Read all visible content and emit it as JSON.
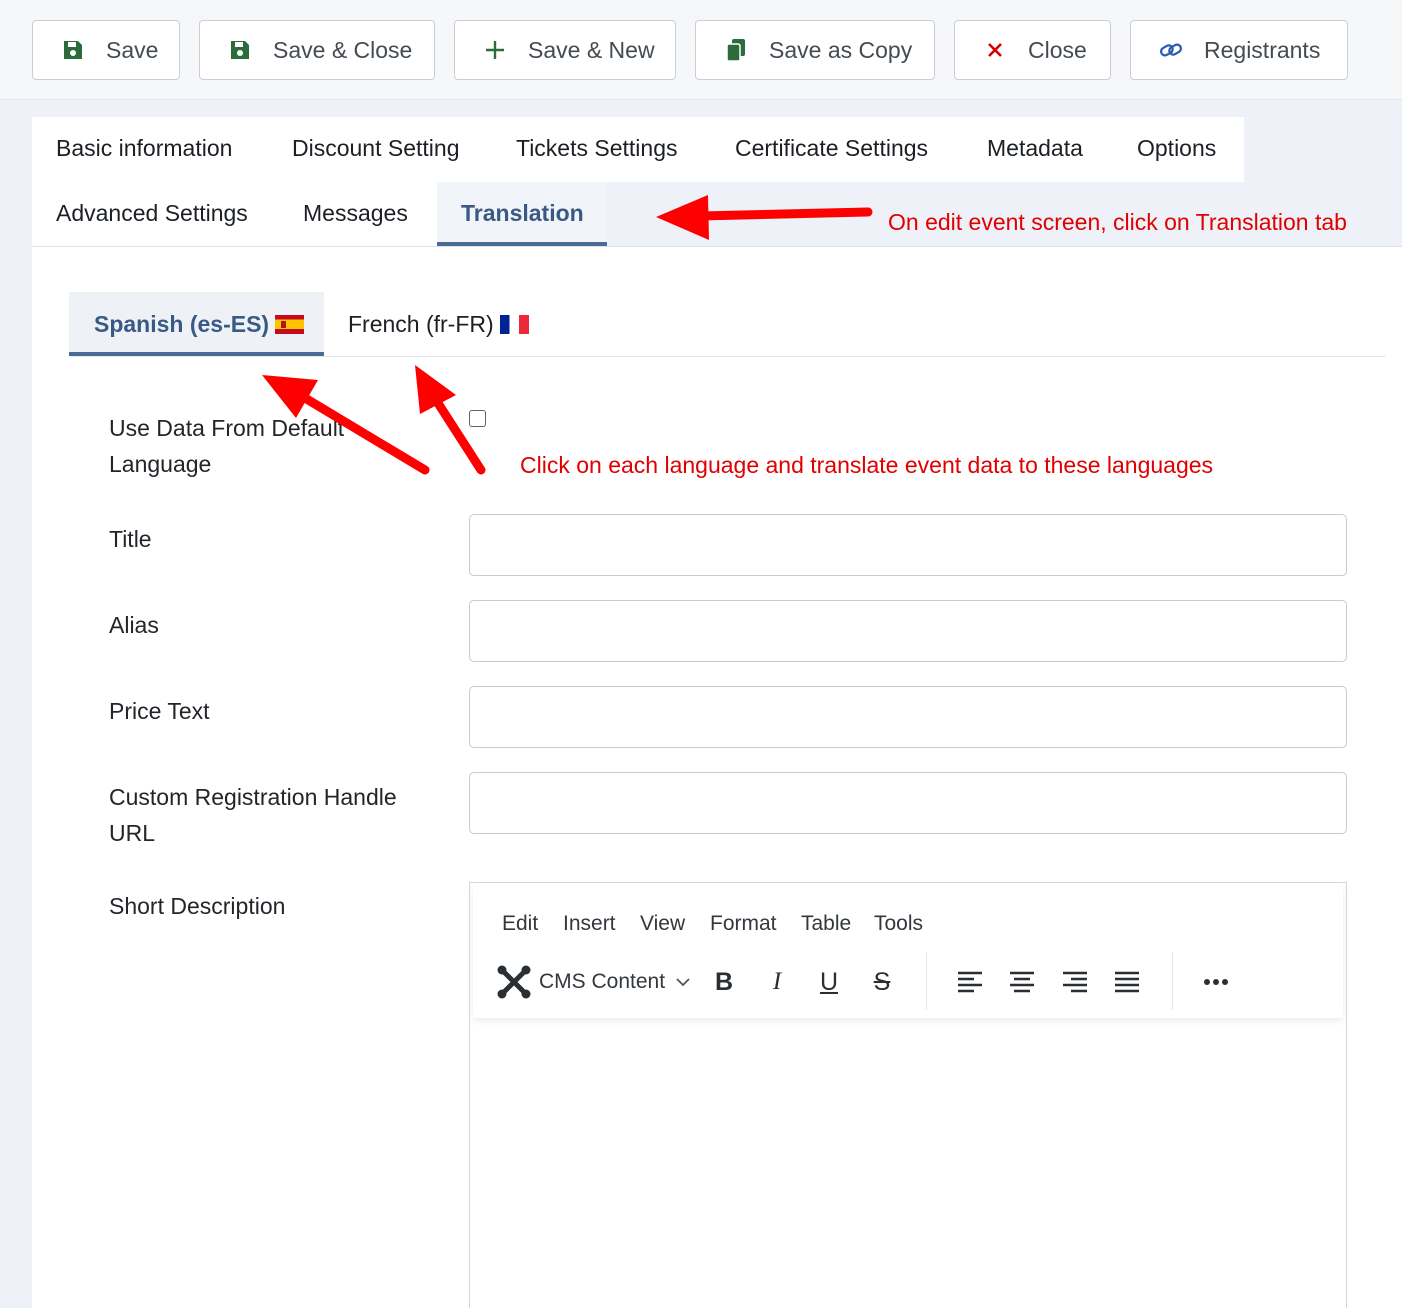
{
  "toolbar": {
    "save": "Save",
    "save_close": "Save & Close",
    "save_new": "Save & New",
    "save_copy": "Save as Copy",
    "close": "Close",
    "registrants": "Registrants"
  },
  "main_tabs": [
    {
      "label": "Basic information"
    },
    {
      "label": "Discount Setting"
    },
    {
      "label": "Tickets Settings"
    },
    {
      "label": "Certificate Settings"
    },
    {
      "label": "Metadata"
    },
    {
      "label": "Options"
    },
    {
      "label": "Advanced Settings"
    },
    {
      "label": "Messages"
    },
    {
      "label": "Translation",
      "active": true
    }
  ],
  "language_tabs": [
    {
      "label": "Spanish (es-ES)",
      "active": true
    },
    {
      "label": "French (fr-FR)"
    }
  ],
  "form": {
    "use_default_line1": "Use Data From Default",
    "use_default_line2": "Language",
    "title": "Title",
    "alias": "Alias",
    "price_text": "Price Text",
    "custom_url_line1": "Custom Registration Handle",
    "custom_url_line2": "URL",
    "short_description": "Short Description"
  },
  "editor": {
    "menu": [
      "Edit",
      "Insert",
      "View",
      "Format",
      "Table",
      "Tools"
    ],
    "cms_content": "CMS Content"
  },
  "annotations": {
    "translation_hint": "On edit event screen, click on Translation tab",
    "language_hint": "Click on each language and translate event data to these languages"
  },
  "colors": {
    "accent": "#4a6b94",
    "annotation": "#e00000",
    "save_icon": "#2e6b3a",
    "close_icon": "#d40000",
    "link_icon": "#2a5bb5"
  }
}
